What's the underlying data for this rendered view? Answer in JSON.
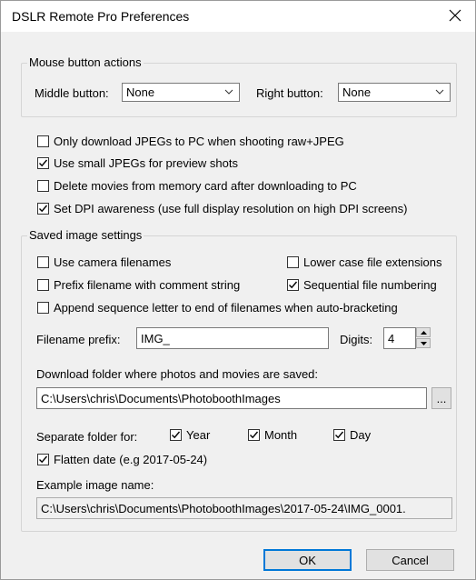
{
  "window": {
    "title": "DSLR Remote Pro Preferences"
  },
  "mouse_actions": {
    "group_label": "Mouse button actions",
    "middle_label": "Middle button:",
    "middle_value": "None",
    "right_label": "Right button:",
    "right_value": "None"
  },
  "options": [
    {
      "label": "Only download JPEGs to PC when shooting raw+JPEG",
      "checked": false
    },
    {
      "label": "Use small JPEGs for preview shots",
      "checked": true
    },
    {
      "label": "Delete movies from memory card after downloading to PC",
      "checked": false
    },
    {
      "label": "Set DPI awareness (use full display resolution on high DPI screens)",
      "checked": true
    }
  ],
  "saved": {
    "group_label": "Saved image settings",
    "use_camera_filenames": {
      "label": "Use camera filenames",
      "checked": false
    },
    "lower_case_ext": {
      "label": "Lower case file extensions",
      "checked": false
    },
    "prefix_comment": {
      "label": "Prefix filename with comment string",
      "checked": false
    },
    "sequential_numbering": {
      "label": "Sequential file numbering",
      "checked": true
    },
    "append_letter": {
      "label": "Append sequence letter to end of filenames when auto-bracketing",
      "checked": false
    },
    "prefix_label": "Filename prefix:",
    "prefix_value": "IMG_",
    "digits_label": "Digits:",
    "digits_value": "4",
    "folder_label": "Download folder where photos and movies are saved:",
    "folder_value": "C:\\Users\\chris\\Documents\\PhotoboothImages",
    "browse_label": "...",
    "separate_label": "Separate folder for:",
    "year": {
      "label": "Year",
      "checked": true
    },
    "month": {
      "label": "Month",
      "checked": true
    },
    "day": {
      "label": "Day",
      "checked": true
    },
    "flatten": {
      "label": "Flatten date (e.g 2017-05-24)",
      "checked": true
    },
    "example_label": "Example image name:",
    "example_value": "C:\\Users\\chris\\Documents\\PhotoboothImages\\2017-05-24\\IMG_0001."
  },
  "buttons": {
    "ok": "OK",
    "cancel": "Cancel"
  },
  "icons": {
    "close": "close-icon",
    "dropdown": "chevron-down-icon",
    "check": "checkmark-icon"
  }
}
